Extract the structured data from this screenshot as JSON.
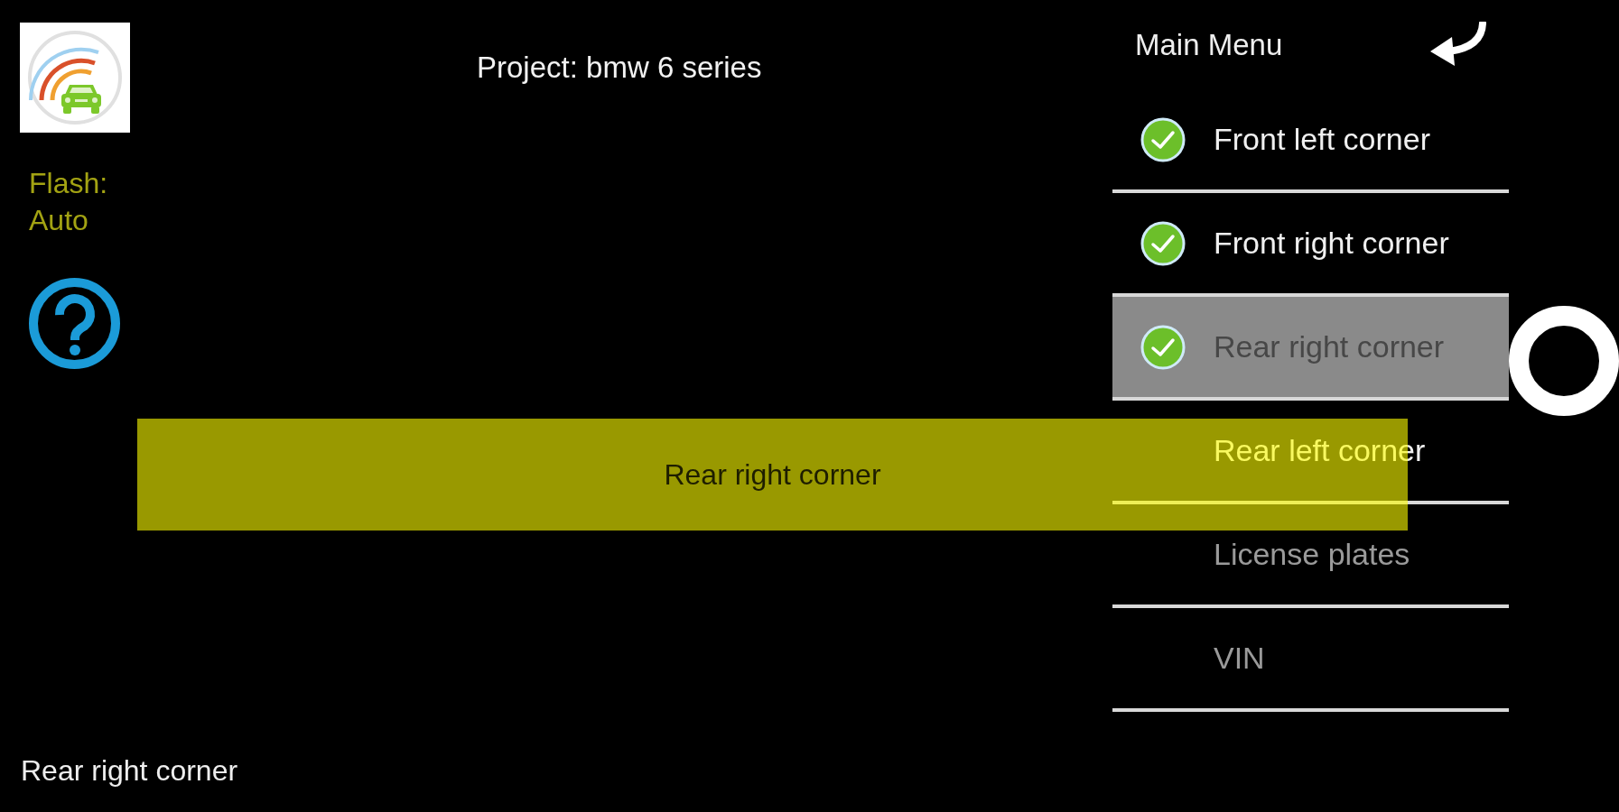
{
  "header": {
    "project_title": "Project: bmw 6 series"
  },
  "camera_panel": {
    "flash": "Flash: Auto"
  },
  "menu": {
    "title": "Main Menu",
    "items": [
      {
        "label": "Front left corner",
        "checked": true,
        "selected": false,
        "disabled": false
      },
      {
        "label": "Front right corner",
        "checked": true,
        "selected": false,
        "disabled": false
      },
      {
        "label": "Rear right corner",
        "checked": true,
        "selected": true,
        "disabled": false
      },
      {
        "label": "Rear left corner",
        "checked": false,
        "selected": false,
        "disabled": false
      },
      {
        "label": "License plates",
        "checked": false,
        "selected": false,
        "disabled": true
      },
      {
        "label": "VIN",
        "checked": false,
        "selected": false,
        "disabled": true
      }
    ]
  },
  "toast": {
    "text": "Rear right corner"
  },
  "status_caption": "Rear right corner"
}
